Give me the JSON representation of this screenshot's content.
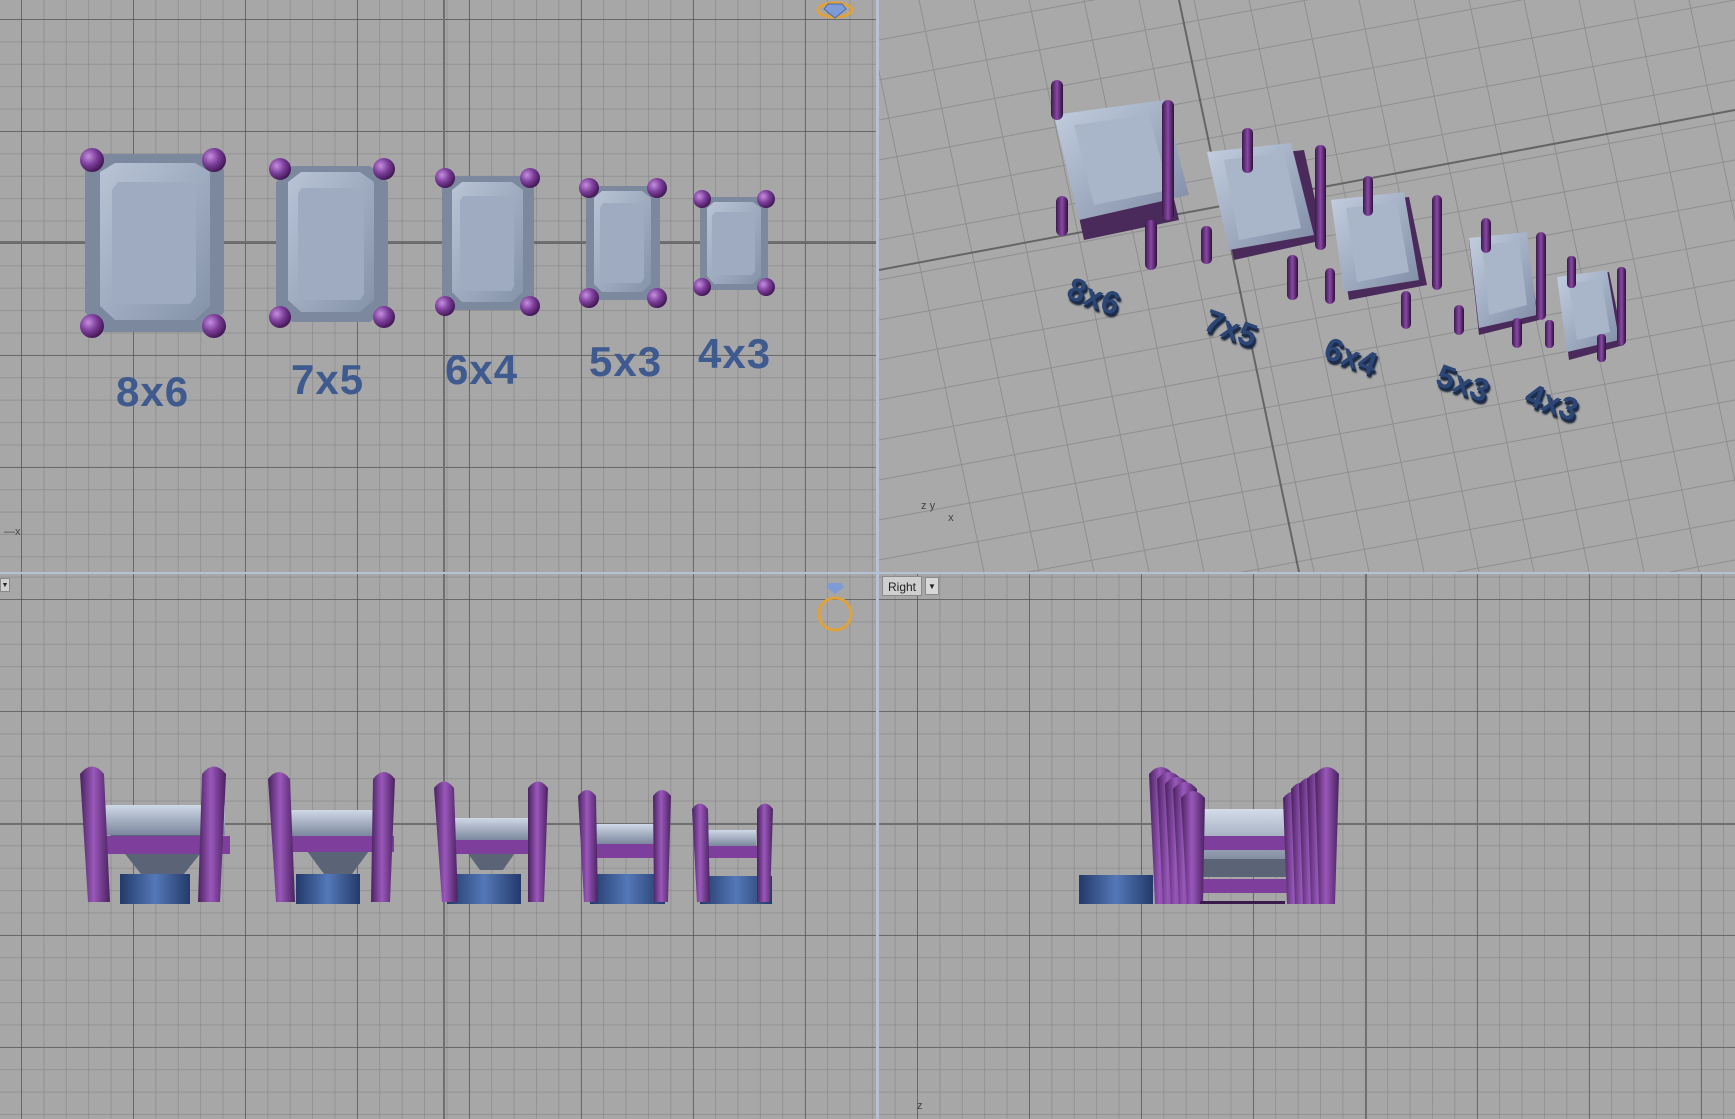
{
  "viewports": {
    "top": {
      "labels": [
        "8x6",
        "7x5",
        "6x4",
        "5x3",
        "4x3"
      ]
    },
    "perspective": {
      "labels": [
        "8x6",
        "7x5",
        "6x4",
        "5x3",
        "4x3"
      ]
    },
    "front": {
      "dropdown_icon": "chevron-down-icon"
    },
    "right": {
      "title": "Right",
      "dropdown_icon": "chevron-down-icon"
    }
  },
  "axes": {
    "x": "x",
    "y": "y",
    "z": "z"
  },
  "colors": {
    "stone": "#9aa7bc",
    "prong": "#7a3f96",
    "label": "#3f5a8e",
    "base": "#2f4d86"
  }
}
